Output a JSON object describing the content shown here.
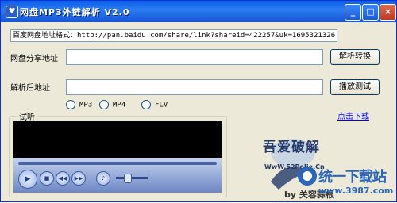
{
  "window": {
    "title": "网盘MP3外链解析 V2.0",
    "icon": "app-icon",
    "minimize_glyph": "_",
    "maximize_glyph": "□",
    "close_glyph": "×"
  },
  "format_hint": "百度网盘地址格式：http://pan.baidu.com/share/link?shareid=422257&uk=1695321326",
  "share_label": "网盘分享地址",
  "share_value": "",
  "parse_button": "解析转换",
  "result_label": "解析后地址",
  "result_value": "",
  "play_button": "播放测试",
  "formats": [
    {
      "label": "MP3"
    },
    {
      "label": "MP4"
    },
    {
      "label": "FLV"
    }
  ],
  "download_link": "点击下载",
  "preview_group": "试听",
  "player": {
    "play_glyph": "▶",
    "stop_glyph": "■",
    "prev_glyph": "◀◀",
    "next_glyph": "▶▶",
    "mute_glyph": "♪",
    "volume_level": 0.45
  },
  "logo": {
    "main": "吾爱破解",
    "sub": "WwW.52PoJie.Cn"
  },
  "author": "by 关容蒜根",
  "watermark": {
    "text": "统一下载站",
    "url": "www.3987.com"
  },
  "colors": {
    "titlebar": "#0a5ee8",
    "frame": "#ece9d8",
    "accent": "#2b66b9"
  }
}
